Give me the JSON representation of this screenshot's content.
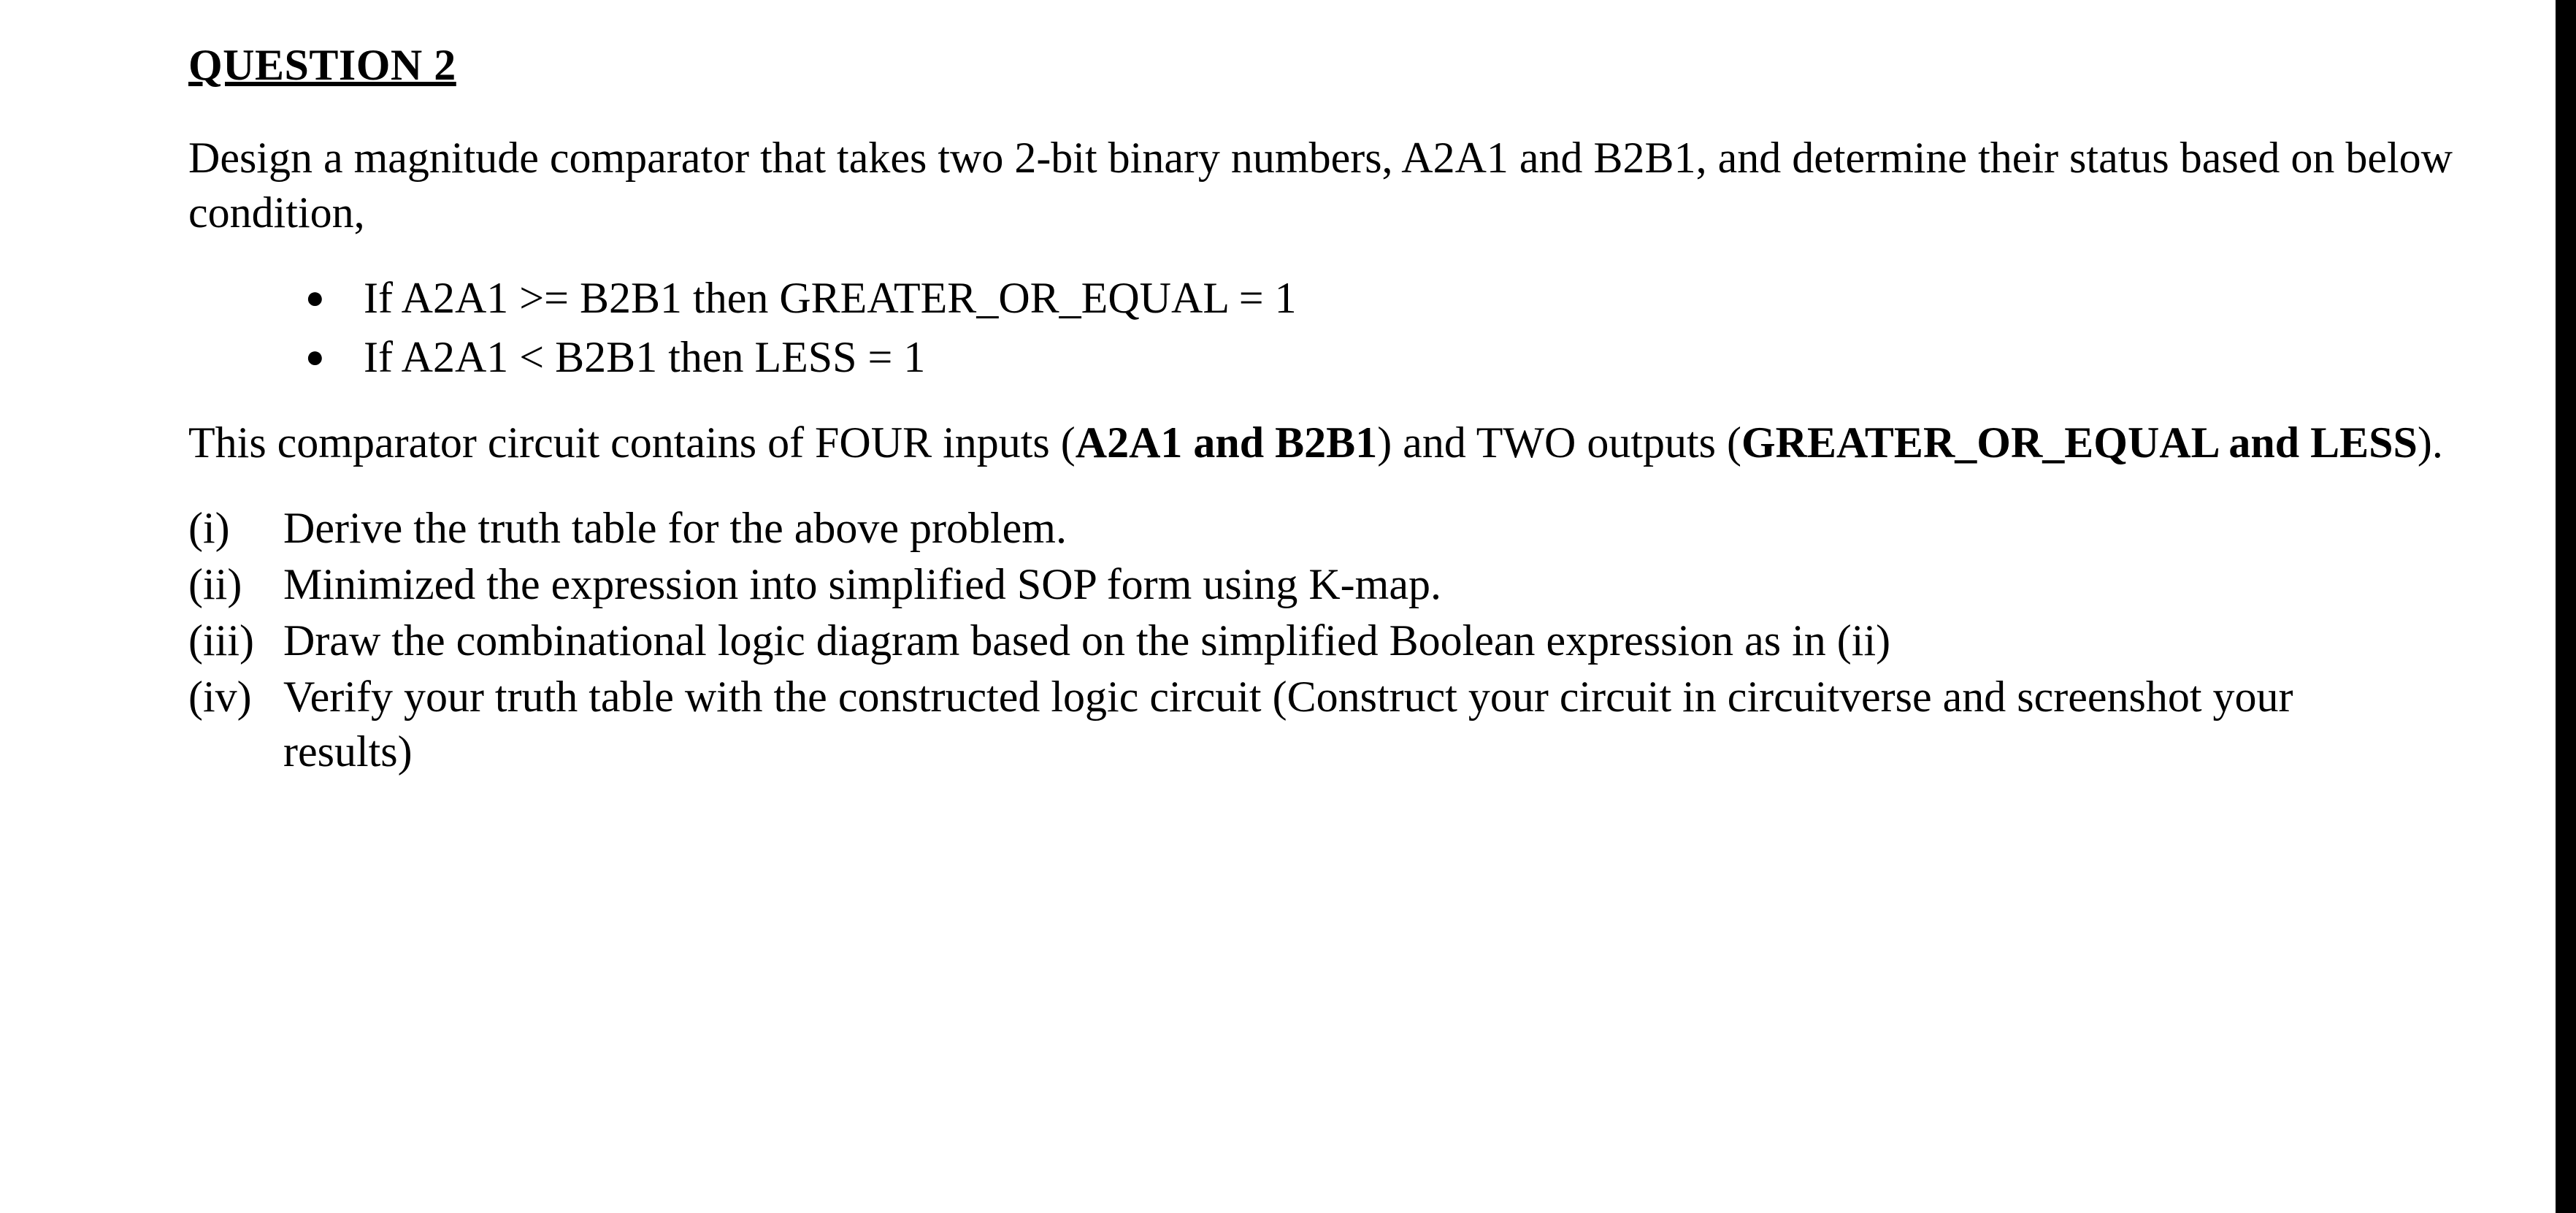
{
  "title": "QUESTION 2",
  "intro": "Design a magnitude comparator that takes two 2-bit binary numbers, A2A1 and B2B1, and determine their status based on below condition,",
  "bullets": [
    "If A2A1 >= B2B1 then GREATER_OR_EQUAL = 1",
    "If A2A1 <  B2B1 then LESS = 1"
  ],
  "para2_pre": "This comparator circuit contains of FOUR inputs (",
  "para2_b1": "A2A1 and B2B1",
  "para2_mid": ") and TWO outputs (",
  "para2_b2": "GREATER_OR_EQUAL and LESS",
  "para2_post": ").",
  "tasks": [
    {
      "num": "(i)",
      "text": "Derive the truth table for the above problem."
    },
    {
      "num": "(ii)",
      "text": "Minimized the expression into simplified SOP form using K-map."
    },
    {
      "num": "(iii)",
      "text": "Draw the combinational logic diagram based on the simplified Boolean expression as in (ii)"
    },
    {
      "num": "(iv)",
      "text": "Verify your truth table with the constructed logic circuit (Construct your circuit in circuitverse and screenshot your results)"
    }
  ]
}
